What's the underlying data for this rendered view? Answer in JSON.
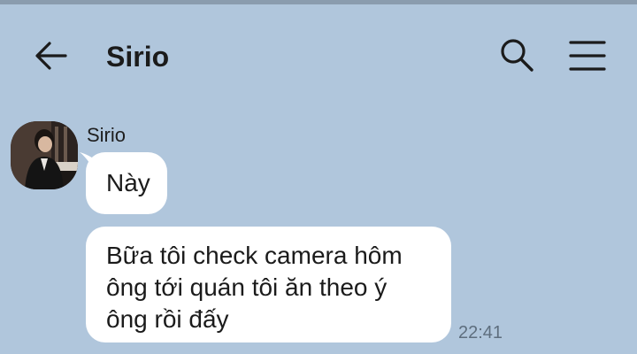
{
  "header": {
    "title": "Sirio",
    "back_icon": "arrow-left-icon",
    "search_icon": "search-icon",
    "menu_icon": "hamburger-menu-icon"
  },
  "chat": {
    "sender_name": "Sirio",
    "messages": [
      {
        "text": "Này"
      },
      {
        "text": "Bữa tôi check camera hôm\nông tới quán tôi ăn theo ý\nông rồi đấy",
        "time": "22:41"
      }
    ]
  },
  "colors": {
    "background": "#b0c6dc",
    "bubble": "#ffffff",
    "text": "#1b1b1b",
    "timestamp": "#5e6e7e"
  }
}
